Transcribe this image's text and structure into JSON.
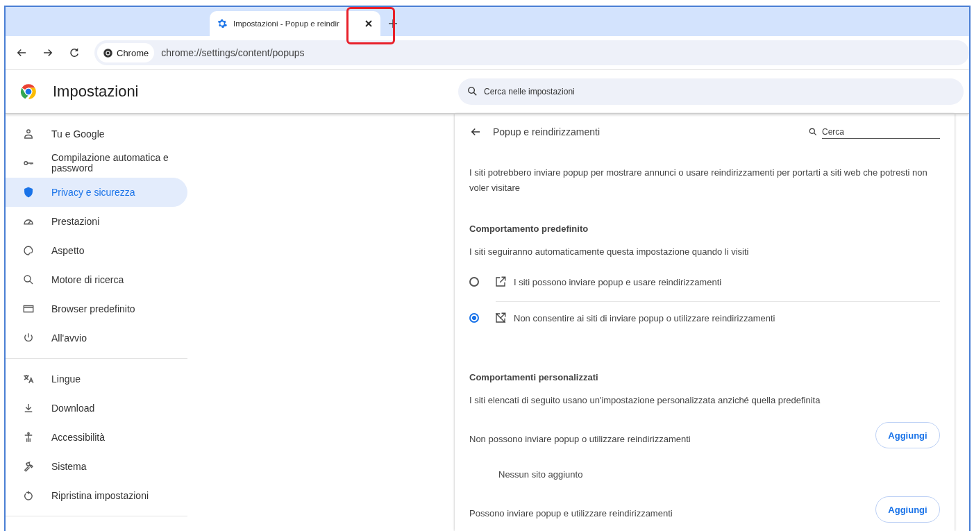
{
  "tab": {
    "title": "Impostazioni - Popup e reindir",
    "selected": true
  },
  "toolbar": {
    "chip": "Chrome",
    "url": "chrome://settings/content/popups"
  },
  "header": {
    "title": "Impostazioni",
    "search": {
      "placeholder": "Cerca nelle impostazioni"
    }
  },
  "sidebar": {
    "groups": [
      {
        "items": [
          {
            "label": "Tu e Google",
            "selected": false
          },
          {
            "label": "Compilazione automatica e password",
            "selected": false
          },
          {
            "label": "Privacy e sicurezza",
            "selected": true
          },
          {
            "label": "Prestazioni",
            "selected": false
          },
          {
            "label": "Aspetto",
            "selected": false
          },
          {
            "label": "Motore di ricerca",
            "selected": false
          },
          {
            "label": "Browser predefinito",
            "selected": false
          },
          {
            "label": "All'avvio",
            "selected": false
          }
        ]
      },
      {
        "items": [
          {
            "label": "Lingue",
            "selected": false
          },
          {
            "label": "Download",
            "selected": false
          },
          {
            "label": "Accessibilità",
            "selected": false
          },
          {
            "label": "Sistema",
            "selected": false
          },
          {
            "label": "Ripristina impostazioni",
            "selected": false
          }
        ]
      }
    ]
  },
  "page": {
    "title": "Popup e reindirizzamenti",
    "search": {
      "placeholder": "Cerca"
    },
    "description": "I siti potrebbero inviare popup per mostrare annunci o usare reindirizzamenti per portarti a siti web che potresti non voler visitare",
    "default_section": {
      "heading": "Comportamento predefinito",
      "subtitle": "I siti seguiranno automaticamente questa impostazione quando li visiti",
      "options": [
        {
          "kind": "allow",
          "label": "I siti possono inviare popup e usare reindirizzamenti",
          "selected": false
        },
        {
          "kind": "block",
          "label": "Non consentire ai siti di inviare popup o utilizzare reindirizzamenti",
          "selected": true
        }
      ]
    },
    "custom_section": {
      "heading": "Comportamenti personalizzati",
      "subtitle": "I siti elencati di seguito usano un'impostazione personalizzata anziché quella predefinita",
      "lists": [
        {
          "label": "Non possono inviare popup o utilizzare reindirizzamenti",
          "button": "Aggiungi",
          "empty": "Nessun sito aggiunto"
        },
        {
          "label": "Possono inviare popup e utilizzare reindirizzamenti",
          "button": "Aggiungi"
        }
      ]
    }
  }
}
